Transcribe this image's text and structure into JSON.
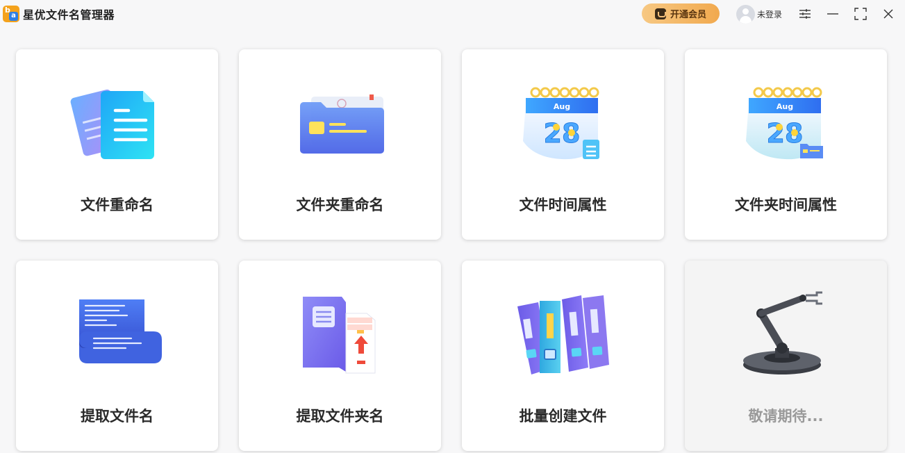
{
  "app": {
    "title": "星优文件名管理器"
  },
  "header": {
    "vip_label": "开通会员",
    "login_label": "未登录"
  },
  "cards": [
    {
      "label": "文件重命名",
      "icon": "documents-icon"
    },
    {
      "label": "文件夹重命名",
      "icon": "folder-icon"
    },
    {
      "label": "文件时间属性",
      "icon": "calendar-file-icon"
    },
    {
      "label": "文件夹时间属性",
      "icon": "calendar-folder-icon"
    },
    {
      "label": "提取文件名",
      "icon": "scroll-icon"
    },
    {
      "label": "提取文件夹名",
      "icon": "folder-book-icon"
    },
    {
      "label": "批量创建文件",
      "icon": "binders-icon"
    },
    {
      "label": "敬请期待...",
      "icon": "robot-arm-icon"
    }
  ],
  "calendar": {
    "month": "Aug",
    "day": "28"
  },
  "colors": {
    "accent_gold": "#f1a94e",
    "icon_blue": "#4a7cf0",
    "icon_purple": "#8a6cf2",
    "icon_cyan": "#25d3f5"
  }
}
